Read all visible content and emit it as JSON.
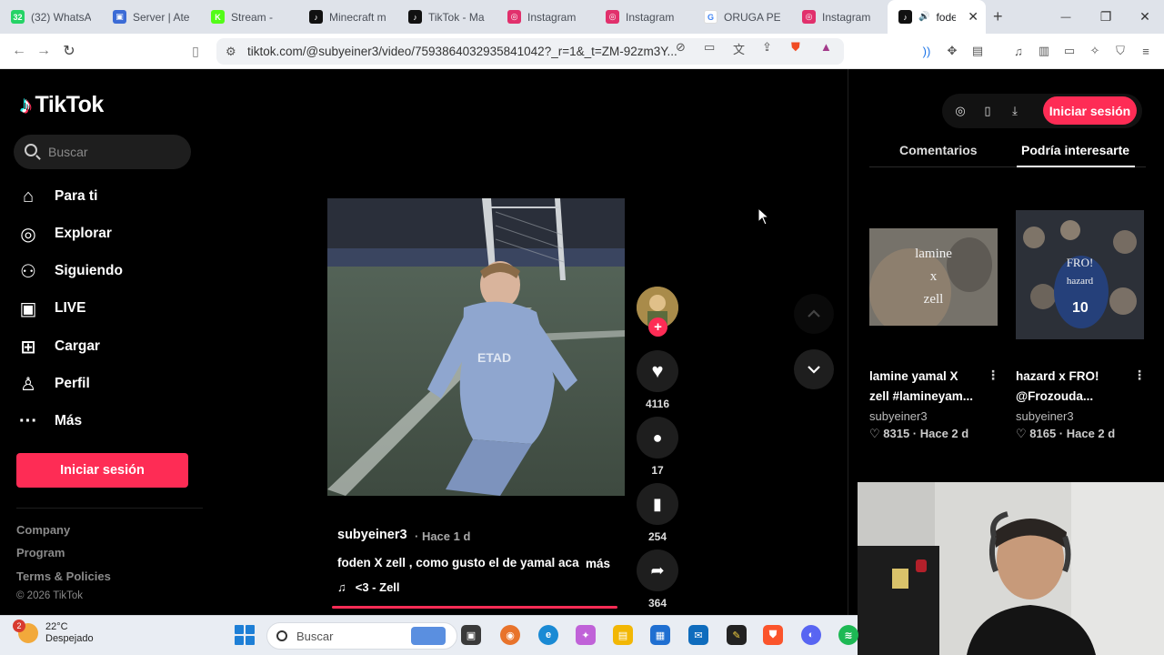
{
  "browser": {
    "tabs": [
      {
        "label": "(32) WhatsA",
        "color": "#25d366",
        "glyph": "32"
      },
      {
        "label": "Server | Ater",
        "color": "#3b6bd6",
        "glyph": "▣"
      },
      {
        "label": "Stream -",
        "color": "#53fc18",
        "glyph": "K"
      },
      {
        "label": "Minecraft m",
        "color": "#111111",
        "glyph": "♪"
      },
      {
        "label": "TikTok - Ma",
        "color": "#111111",
        "glyph": "♪"
      },
      {
        "label": "Instagram",
        "color": "#e1306c",
        "glyph": "◎"
      },
      {
        "label": "Instagram",
        "color": "#e1306c",
        "glyph": "◎"
      },
      {
        "label": "ORUGA PEL",
        "color": "#ffffff",
        "glyph": "G"
      },
      {
        "label": "Instagram",
        "color": "#e1306c",
        "glyph": "◎"
      },
      {
        "label": "fode",
        "color": "#111111",
        "glyph": "♪"
      }
    ],
    "url": "tiktok.com/@subyeiner3/video/7593864032935841042?_r=1&_t=ZM-92zm3Y...",
    "new_tab": "+",
    "win_min": "—",
    "win_max": "❐",
    "win_close": "✕",
    "tab_close": "✕"
  },
  "tiktok": {
    "logo": "TikTok",
    "search_placeholder": "Buscar",
    "nav": [
      {
        "label": "Para ti",
        "icon": "home-icon",
        "glyph": "⌂"
      },
      {
        "label": "Explorar",
        "icon": "compass-icon",
        "glyph": "◎"
      },
      {
        "label": "Siguiendo",
        "icon": "following-icon",
        "glyph": "⚇"
      },
      {
        "label": "LIVE",
        "icon": "live-icon",
        "glyph": "▣"
      },
      {
        "label": "Cargar",
        "icon": "upload-icon",
        "glyph": "⊞"
      },
      {
        "label": "Perfil",
        "icon": "profile-icon",
        "glyph": "♙"
      },
      {
        "label": "Más",
        "icon": "more-icon",
        "glyph": "···"
      }
    ],
    "login_button": "Iniciar sesión",
    "footer": {
      "links": [
        "Company",
        "Program",
        "Terms & Policies"
      ],
      "copyright": "© 2026 TikTok"
    }
  },
  "video": {
    "author": "subyeiner3",
    "time": "· Hace 1 d",
    "caption": "foden X zell , como gusto el de yamal aca",
    "more": "más",
    "music_note": "♫",
    "music": "<3 - Zell",
    "likes": "4116",
    "comments": "17",
    "saves": "254",
    "shares": "364",
    "follow_plus": "+"
  },
  "right_panel": {
    "login_button": "Iniciar sesión",
    "tabs": [
      "Comentarios",
      "Podría interesarte"
    ],
    "active_tab": "Podría interesarte",
    "cards": [
      {
        "thumb_text": [
          "lamine",
          "x",
          "zell"
        ],
        "title_line1": "lamine yamal X",
        "title_line2": "zell #lamineyam...",
        "user": "subyeiner3",
        "stat": "♡ 8315 · Hace 2 d",
        "kebab": "⋮"
      },
      {
        "thumb_text": [
          "FRO!",
          "hazard"
        ],
        "title_line1": "hazard x FRO!",
        "title_line2": "@Frozouda...",
        "user": "subyeiner3",
        "stat": "♡ 8165 · Hace 2 d",
        "kebab": "⋮"
      }
    ]
  },
  "taskbar": {
    "temp": "22°C",
    "weather": "Despejado",
    "weather_badge": "2",
    "search_placeholder": "Buscar"
  }
}
